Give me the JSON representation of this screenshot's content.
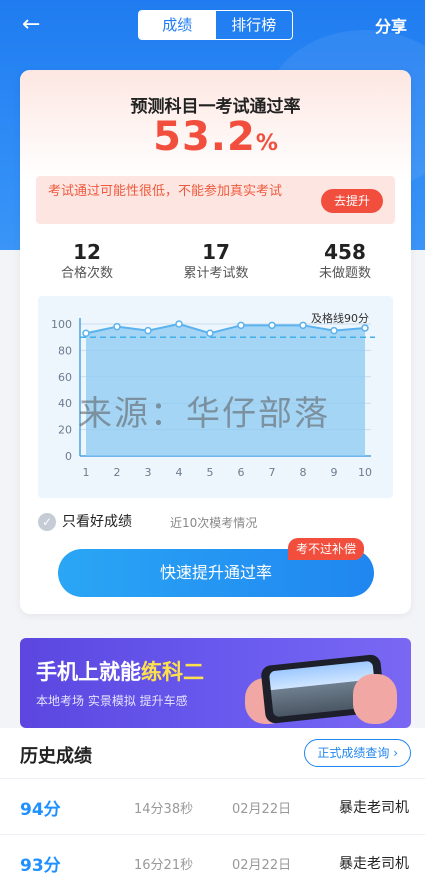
{
  "topbar": {
    "tabs": [
      {
        "label": "成绩",
        "active": true
      },
      {
        "label": "排行榜",
        "active": false
      }
    ],
    "share_label": "分享"
  },
  "card": {
    "title": "预测科目一考试通过率",
    "rate": "53.2",
    "rate_unit": "%",
    "warning": "考试通过可能性很低，不能参加真实考试",
    "improve_label": "去提升",
    "stats": [
      {
        "value": "12",
        "label": "合格次数"
      },
      {
        "value": "17",
        "label": "累计考试数"
      },
      {
        "value": "458",
        "label": "未做题数"
      }
    ],
    "filter_label": "只看好成绩",
    "filter_sub": "近10次模考情况",
    "quick_label": "快速提升通过率",
    "compensate_label": "考不过补偿"
  },
  "chart_data": {
    "type": "area",
    "x": [
      1,
      2,
      3,
      4,
      5,
      6,
      7,
      8,
      9,
      10
    ],
    "values": [
      93,
      98,
      95,
      100,
      93,
      99,
      99,
      99,
      95,
      97
    ],
    "ylim": [
      0,
      100
    ],
    "yticks": [
      0,
      20,
      40,
      60,
      80,
      100
    ],
    "pass_line": 90,
    "pass_line_label": "及格线90分",
    "grid": true,
    "colors": {
      "line": "#5ab2ee",
      "fill": "#8cc9f1",
      "pass": "#3fb0e8"
    }
  },
  "watermark": "来源：华仔部落",
  "banner": {
    "title_prefix": "手机上就能",
    "title_highlight": "练科二",
    "subtitle": "本地考场 实景模拟 提升车感"
  },
  "history": {
    "title": "历史成绩",
    "query_label": "正式成绩查询 ›",
    "rows": [
      {
        "score": "94分",
        "duration": "14分38秒",
        "date": "02月22日",
        "name": "暴走老司机"
      },
      {
        "score": "93分",
        "duration": "16分21秒",
        "date": "02月22日",
        "name": "暴走老司机"
      }
    ]
  }
}
